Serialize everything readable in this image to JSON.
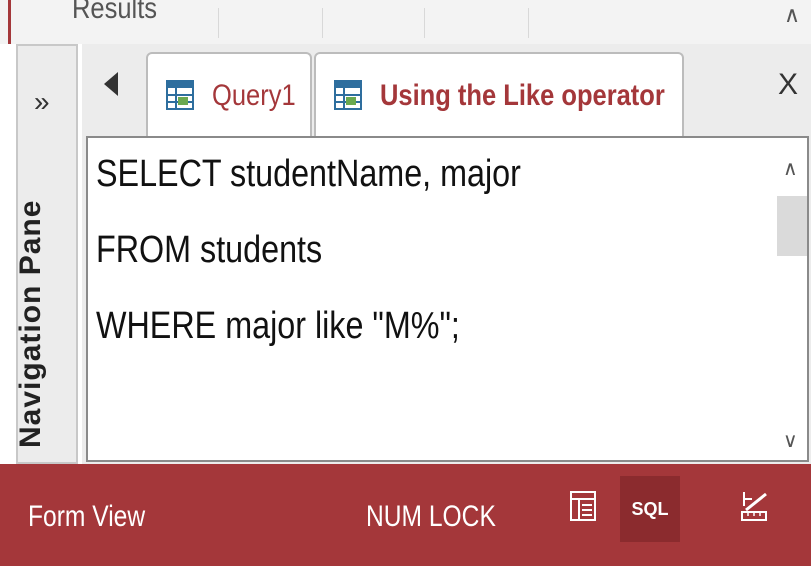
{
  "ribbon": {
    "group_label": "Results"
  },
  "nav_pane": {
    "label": "Navigation Pane",
    "expand_glyph": "»"
  },
  "tabs": [
    {
      "label": "Query1",
      "active": false,
      "icon": "query-icon"
    },
    {
      "label": "Using the Like operator",
      "active": true,
      "icon": "query-icon"
    }
  ],
  "tab_close_glyph": "X",
  "editor": {
    "lines": [
      "SELECT studentName, major",
      "FROM students",
      "WHERE major like \"M%\";"
    ]
  },
  "status": {
    "view_name": "Form View",
    "num_lock": "NUM LOCK",
    "sql_label": "SQL"
  },
  "colors": {
    "accent": "#a4373a",
    "accent_dark": "#8b2b2e"
  }
}
